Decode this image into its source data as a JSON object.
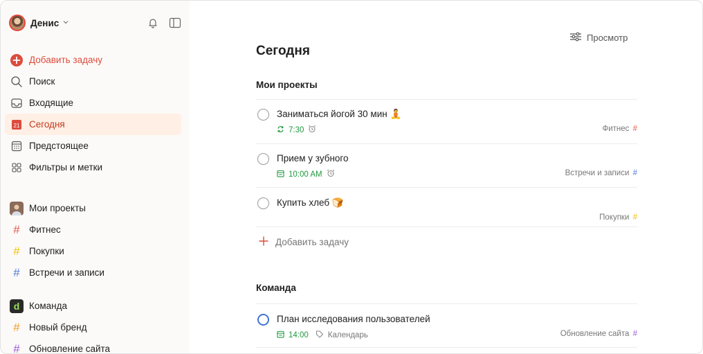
{
  "colors": {
    "accent": "#dc4c3e",
    "active_bg": "#ffefe5",
    "green": "#1f9a3f",
    "fitness": "#e05d4b",
    "shopping": "#f5c000",
    "meetings": "#4f7be0",
    "new_brand": "#f29b25",
    "site_update": "#9b5cdb",
    "blue_circle": "#4073d6"
  },
  "sidebar": {
    "user_name": "Денис",
    "top_icons": [
      "bell-icon",
      "sidebar-toggle-icon"
    ],
    "nav": [
      {
        "label": "Добавить задачу",
        "icon": "plus-circle-icon"
      },
      {
        "label": "Поиск",
        "icon": "search-icon"
      },
      {
        "label": "Входящие",
        "icon": "inbox-icon"
      },
      {
        "label": "Сегодня",
        "icon": "calendar-today-icon",
        "day": "21"
      },
      {
        "label": "Предстоящее",
        "icon": "calendar-grid-icon"
      },
      {
        "label": "Фильтры и метки",
        "icon": "filters-icon"
      }
    ],
    "my_projects_header": "Мои проекты",
    "my_projects": [
      {
        "label": "Фитнес",
        "color": "#e05d4b"
      },
      {
        "label": "Покупки",
        "color": "#f5c000"
      },
      {
        "label": "Встречи и записи",
        "color": "#4f7be0"
      }
    ],
    "team_header": "Команда",
    "team_logo": "d",
    "team_projects": [
      {
        "label": "Новый бренд",
        "color": "#f29b25"
      },
      {
        "label": "Обновление сайта",
        "color": "#9b5cdb"
      }
    ]
  },
  "main": {
    "view_label": "Просмотр",
    "title": "Сегодня",
    "section_my_projects": "Мои проекты",
    "tasks": [
      {
        "title": "Заниматься йогой 30 мин",
        "emoji": "🧘",
        "time": "7:30",
        "time_icon": "recurring-icon",
        "alarm_icon": "alarm-icon",
        "project": "Фитнес"
      },
      {
        "title": "Прием у зубного",
        "time": "10:00 AM",
        "time_icon": "calendar-icon",
        "alarm_icon": "alarm-icon",
        "project": "Встречи и записи"
      },
      {
        "title": "Купить хлеб",
        "emoji": "🍞",
        "project": "Покупки"
      }
    ],
    "add_task_label": "Добавить задачу",
    "section_team": "Команда",
    "team_tasks": [
      {
        "title": "План исследования пользователей",
        "time": "14:00",
        "time_icon": "calendar-icon",
        "label_icon": "tag-icon",
        "label": "Календарь",
        "project": "Обновление сайта"
      }
    ]
  }
}
